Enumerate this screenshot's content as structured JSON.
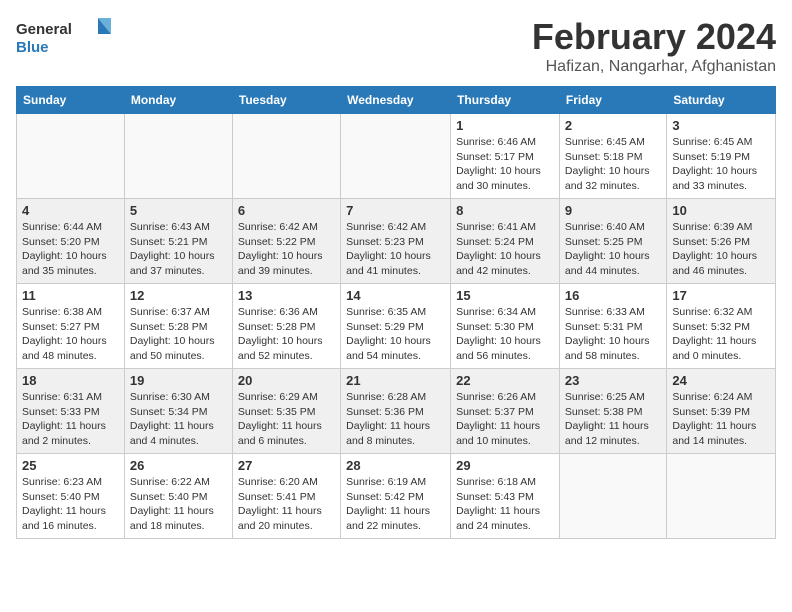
{
  "header": {
    "logo_general": "General",
    "logo_blue": "Blue",
    "month_title": "February 2024",
    "location": "Hafizan, Nangarhar, Afghanistan"
  },
  "days_of_week": [
    "Sunday",
    "Monday",
    "Tuesday",
    "Wednesday",
    "Thursday",
    "Friday",
    "Saturday"
  ],
  "weeks": [
    [
      {
        "day": "",
        "content": ""
      },
      {
        "day": "",
        "content": ""
      },
      {
        "day": "",
        "content": ""
      },
      {
        "day": "",
        "content": ""
      },
      {
        "day": "1",
        "content": "Sunrise: 6:46 AM\nSunset: 5:17 PM\nDaylight: 10 hours\nand 30 minutes."
      },
      {
        "day": "2",
        "content": "Sunrise: 6:45 AM\nSunset: 5:18 PM\nDaylight: 10 hours\nand 32 minutes."
      },
      {
        "day": "3",
        "content": "Sunrise: 6:45 AM\nSunset: 5:19 PM\nDaylight: 10 hours\nand 33 minutes."
      }
    ],
    [
      {
        "day": "4",
        "content": "Sunrise: 6:44 AM\nSunset: 5:20 PM\nDaylight: 10 hours\nand 35 minutes."
      },
      {
        "day": "5",
        "content": "Sunrise: 6:43 AM\nSunset: 5:21 PM\nDaylight: 10 hours\nand 37 minutes."
      },
      {
        "day": "6",
        "content": "Sunrise: 6:42 AM\nSunset: 5:22 PM\nDaylight: 10 hours\nand 39 minutes."
      },
      {
        "day": "7",
        "content": "Sunrise: 6:42 AM\nSunset: 5:23 PM\nDaylight: 10 hours\nand 41 minutes."
      },
      {
        "day": "8",
        "content": "Sunrise: 6:41 AM\nSunset: 5:24 PM\nDaylight: 10 hours\nand 42 minutes."
      },
      {
        "day": "9",
        "content": "Sunrise: 6:40 AM\nSunset: 5:25 PM\nDaylight: 10 hours\nand 44 minutes."
      },
      {
        "day": "10",
        "content": "Sunrise: 6:39 AM\nSunset: 5:26 PM\nDaylight: 10 hours\nand 46 minutes."
      }
    ],
    [
      {
        "day": "11",
        "content": "Sunrise: 6:38 AM\nSunset: 5:27 PM\nDaylight: 10 hours\nand 48 minutes."
      },
      {
        "day": "12",
        "content": "Sunrise: 6:37 AM\nSunset: 5:28 PM\nDaylight: 10 hours\nand 50 minutes."
      },
      {
        "day": "13",
        "content": "Sunrise: 6:36 AM\nSunset: 5:28 PM\nDaylight: 10 hours\nand 52 minutes."
      },
      {
        "day": "14",
        "content": "Sunrise: 6:35 AM\nSunset: 5:29 PM\nDaylight: 10 hours\nand 54 minutes."
      },
      {
        "day": "15",
        "content": "Sunrise: 6:34 AM\nSunset: 5:30 PM\nDaylight: 10 hours\nand 56 minutes."
      },
      {
        "day": "16",
        "content": "Sunrise: 6:33 AM\nSunset: 5:31 PM\nDaylight: 10 hours\nand 58 minutes."
      },
      {
        "day": "17",
        "content": "Sunrise: 6:32 AM\nSunset: 5:32 PM\nDaylight: 11 hours\nand 0 minutes."
      }
    ],
    [
      {
        "day": "18",
        "content": "Sunrise: 6:31 AM\nSunset: 5:33 PM\nDaylight: 11 hours\nand 2 minutes."
      },
      {
        "day": "19",
        "content": "Sunrise: 6:30 AM\nSunset: 5:34 PM\nDaylight: 11 hours\nand 4 minutes."
      },
      {
        "day": "20",
        "content": "Sunrise: 6:29 AM\nSunset: 5:35 PM\nDaylight: 11 hours\nand 6 minutes."
      },
      {
        "day": "21",
        "content": "Sunrise: 6:28 AM\nSunset: 5:36 PM\nDaylight: 11 hours\nand 8 minutes."
      },
      {
        "day": "22",
        "content": "Sunrise: 6:26 AM\nSunset: 5:37 PM\nDaylight: 11 hours\nand 10 minutes."
      },
      {
        "day": "23",
        "content": "Sunrise: 6:25 AM\nSunset: 5:38 PM\nDaylight: 11 hours\nand 12 minutes."
      },
      {
        "day": "24",
        "content": "Sunrise: 6:24 AM\nSunset: 5:39 PM\nDaylight: 11 hours\nand 14 minutes."
      }
    ],
    [
      {
        "day": "25",
        "content": "Sunrise: 6:23 AM\nSunset: 5:40 PM\nDaylight: 11 hours\nand 16 minutes."
      },
      {
        "day": "26",
        "content": "Sunrise: 6:22 AM\nSunset: 5:40 PM\nDaylight: 11 hours\nand 18 minutes."
      },
      {
        "day": "27",
        "content": "Sunrise: 6:20 AM\nSunset: 5:41 PM\nDaylight: 11 hours\nand 20 minutes."
      },
      {
        "day": "28",
        "content": "Sunrise: 6:19 AM\nSunset: 5:42 PM\nDaylight: 11 hours\nand 22 minutes."
      },
      {
        "day": "29",
        "content": "Sunrise: 6:18 AM\nSunset: 5:43 PM\nDaylight: 11 hours\nand 24 minutes."
      },
      {
        "day": "",
        "content": ""
      },
      {
        "day": "",
        "content": ""
      }
    ]
  ]
}
